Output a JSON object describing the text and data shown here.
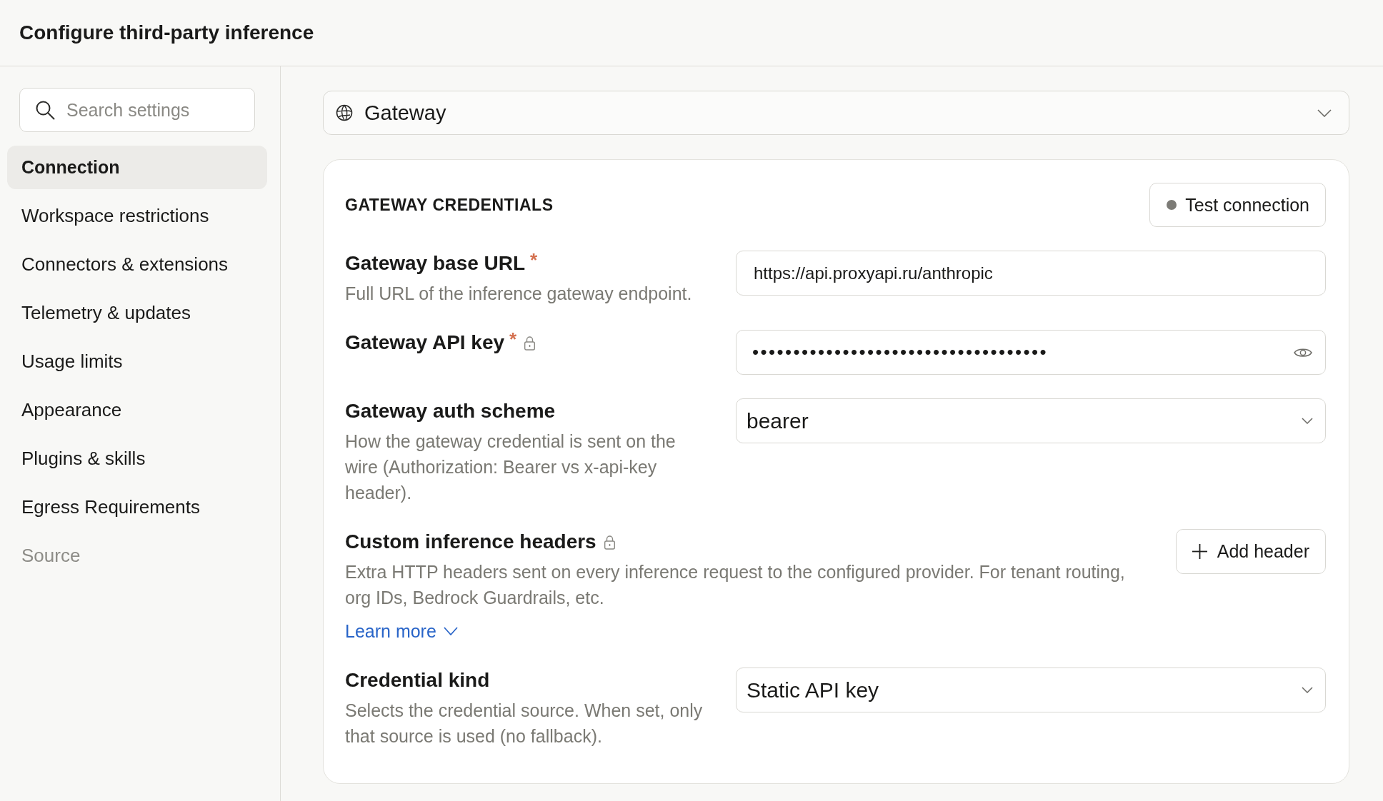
{
  "window": {
    "title": "Configure third-party inference"
  },
  "sidebar": {
    "search": {
      "placeholder": "Search settings"
    },
    "items": [
      {
        "label": "Connection",
        "selected": true,
        "disabled": false
      },
      {
        "label": "Workspace restrictions",
        "selected": false,
        "disabled": false
      },
      {
        "label": "Connectors & extensions",
        "selected": false,
        "disabled": false
      },
      {
        "label": "Telemetry & updates",
        "selected": false,
        "disabled": false
      },
      {
        "label": "Usage limits",
        "selected": false,
        "disabled": false
      },
      {
        "label": "Appearance",
        "selected": false,
        "disabled": false
      },
      {
        "label": "Plugins & skills",
        "selected": false,
        "disabled": false
      },
      {
        "label": "Egress Requirements",
        "selected": false,
        "disabled": false
      },
      {
        "label": "Source",
        "selected": false,
        "disabled": true
      }
    ]
  },
  "provider_select": {
    "value": "Gateway"
  },
  "credentials": {
    "title": "GATEWAY CREDENTIALS",
    "test_button": {
      "label": "Test connection"
    },
    "fields": [
      {
        "kind": "text",
        "label": "Gateway base URL",
        "required_mark": "*",
        "locked": false,
        "description": "Full URL of the inference gateway endpoint.",
        "value": "https://api.proxyapi.ru/anthropic"
      },
      {
        "kind": "secret",
        "label": "Gateway API key",
        "required_mark": "*",
        "locked": true,
        "value": "••••••••••••••••••••••••••••••••••••"
      },
      {
        "kind": "select",
        "label": "Gateway auth scheme",
        "locked": false,
        "description": "How the gateway credential is sent on the wire (Authorization: Bearer vs x-api-key header).",
        "value": "bearer"
      },
      {
        "kind": "headers",
        "label": "Custom inference headers",
        "locked": true,
        "description": "Extra HTTP headers sent on every inference request to the configured provider. For tenant routing, org IDs, Bedrock Guardrails, etc.",
        "button": "Add header",
        "link": {
          "label": "Learn more",
          "expanded": false
        }
      },
      {
        "kind": "select",
        "label": "Credential kind",
        "locked": false,
        "description": "Selects the credential source. When set, only that source is used (no fallback).",
        "value": "Static API key"
      }
    ]
  }
}
